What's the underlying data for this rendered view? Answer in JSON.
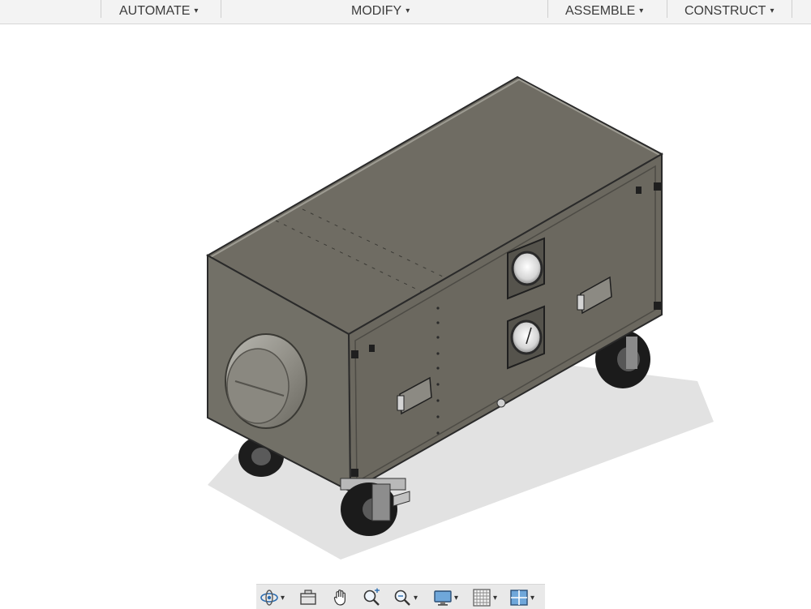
{
  "toolbar": {
    "menus": [
      {
        "label": "AUTOMATE"
      },
      {
        "label": "MODIFY"
      },
      {
        "label": "ASSEMBLE"
      },
      {
        "label": "CONSTRUCT"
      }
    ],
    "dropdown_glyph": "▾"
  },
  "viewport": {
    "background": "#ffffff",
    "model_body_color": "#6e6b62",
    "model_shadow_color": "#dcdcdc"
  },
  "navigation_bar": {
    "tools": [
      {
        "icon": "orbit-icon",
        "has_dropdown": true
      },
      {
        "icon": "look-at-icon",
        "has_dropdown": false
      },
      {
        "icon": "pan-hand-icon",
        "has_dropdown": false
      },
      {
        "icon": "zoom-icon",
        "has_dropdown": false
      },
      {
        "icon": "fit-zoom-icon",
        "has_dropdown": true
      },
      {
        "icon": "display-settings-icon",
        "has_dropdown": true
      },
      {
        "icon": "grid-snaps-icon",
        "has_dropdown": true
      },
      {
        "icon": "viewports-icon",
        "has_dropdown": true
      }
    ],
    "accent_color": "#2b6cb0"
  }
}
